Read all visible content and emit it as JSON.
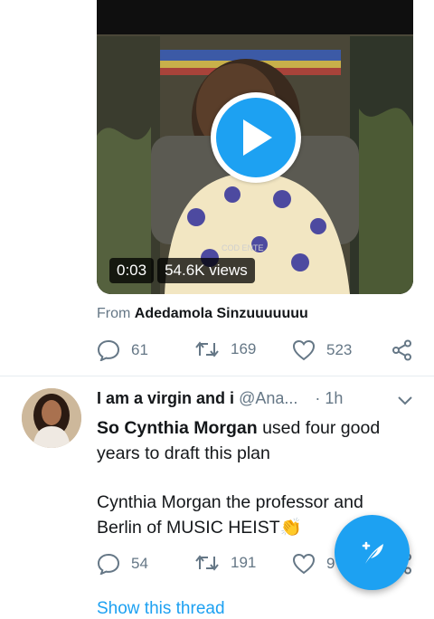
{
  "video": {
    "duration": "0:03",
    "views": "54.6K views",
    "play_icon": "play-icon",
    "watermark": "COD ENTE"
  },
  "from_line": {
    "prefix": "From",
    "author": "Adedamola Sinzuuuuuuu"
  },
  "tweet1_actions": {
    "replies": "61",
    "retweets": "169",
    "likes": "523"
  },
  "tweet2": {
    "display_name": "I am a virgin and i",
    "handle": "@Ana...",
    "time": "· 1h",
    "text_bold": "So Cynthia Morgan",
    "text_rest": " used four good years to draft this plan",
    "text_para2": "Cynthia Morgan the professor and Berlin of MUSIC HEIST",
    "emoji": "👏",
    "replies": "54",
    "retweets": "191",
    "likes": "9",
    "show_thread": "Show this thread"
  },
  "colors": {
    "accent": "#1da1f2",
    "secondary_text": "#657786",
    "divider": "#e6ecf0"
  }
}
